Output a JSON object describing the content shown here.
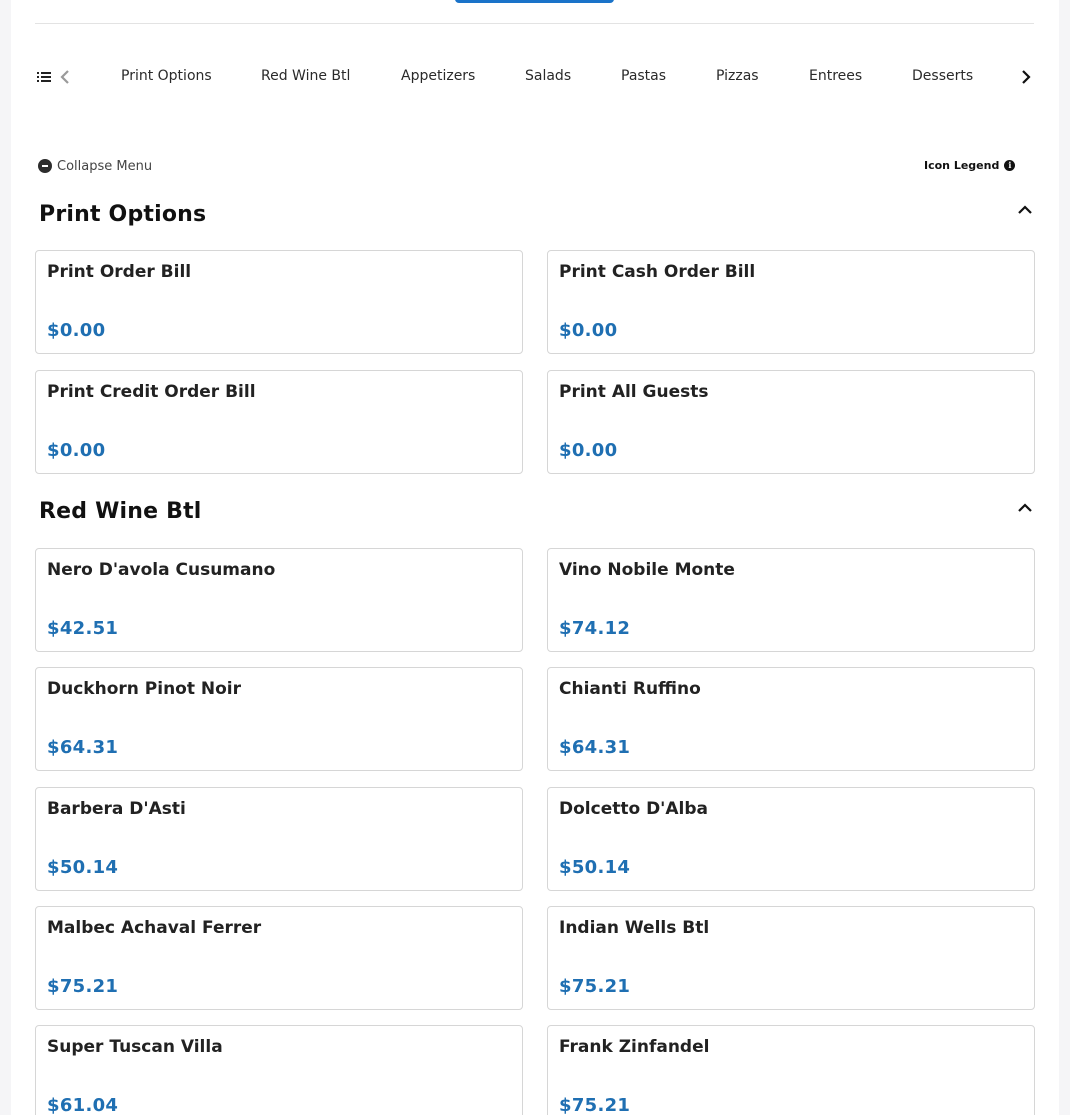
{
  "nav": {
    "categories": [
      "Print Options",
      "Red Wine Btl",
      "Appetizers",
      "Salads",
      "Pastas",
      "Pizzas",
      "Entrees",
      "Desserts"
    ],
    "list_icon": "list-icon",
    "prev_icon": "chevron-left-icon",
    "next_icon": "chevron-right-icon"
  },
  "toolbar": {
    "collapse_label": "Collapse Menu",
    "legend_label": "Icon Legend",
    "info_glyph": "i"
  },
  "sections": [
    {
      "title": "Print Options",
      "items": [
        {
          "name": "Print Order Bill",
          "price": "$0.00"
        },
        {
          "name": "Print Cash Order Bill",
          "price": "$0.00"
        },
        {
          "name": "Print Credit Order Bill",
          "price": "$0.00"
        },
        {
          "name": "Print All Guests",
          "price": "$0.00"
        }
      ]
    },
    {
      "title": "Red Wine Btl",
      "items": [
        {
          "name": "Nero D'avola Cusumano",
          "price": "$42.51"
        },
        {
          "name": "Vino Nobile Monte",
          "price": "$74.12"
        },
        {
          "name": "Duckhorn Pinot Noir",
          "price": "$64.31"
        },
        {
          "name": "Chianti Ruffino",
          "price": "$64.31"
        },
        {
          "name": "Barbera D'Asti",
          "price": "$50.14"
        },
        {
          "name": "Dolcetto D'Alba",
          "price": "$50.14"
        },
        {
          "name": "Malbec Achaval Ferrer",
          "price": "$75.21"
        },
        {
          "name": "Indian Wells Btl",
          "price": "$75.21"
        },
        {
          "name": "Super Tuscan Villa",
          "price": "$61.04"
        },
        {
          "name": "Frank Zinfandel",
          "price": "$75.21"
        }
      ]
    }
  ],
  "colors": {
    "accent": "#1a73c9",
    "price": "#1f6fb2",
    "border": "#d6d6d6"
  }
}
